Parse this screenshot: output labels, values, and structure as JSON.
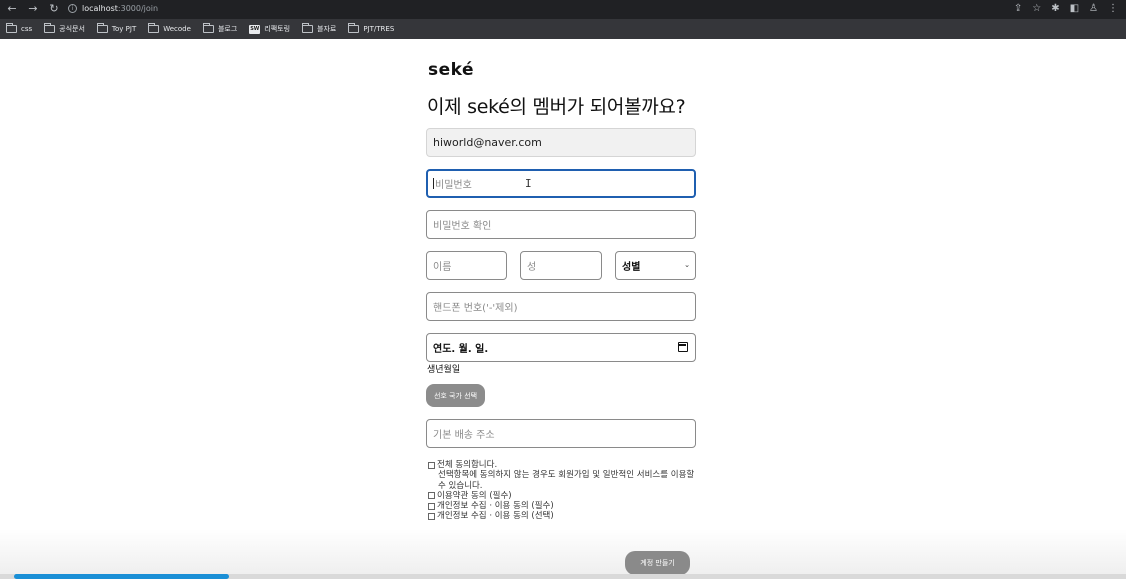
{
  "browser": {
    "url_host": "localhost",
    "url_path": ":3000/join",
    "bookmarks": [
      {
        "label": "css",
        "icon": "folder-icon"
      },
      {
        "label": "공식문서",
        "icon": "folder-icon"
      },
      {
        "label": "Toy PJT",
        "icon": "folder-icon"
      },
      {
        "label": "Wecode",
        "icon": "folder-icon"
      },
      {
        "label": "블로그",
        "icon": "folder-icon"
      },
      {
        "label": "리팩토링",
        "icon": "sw-icon"
      },
      {
        "label": "블자료",
        "icon": "folder-icon"
      },
      {
        "label": "PJT/TRES",
        "icon": "folder-icon"
      }
    ],
    "sw_badge": "SW"
  },
  "form": {
    "logo": "seké",
    "headline": "이제 seké의 멤버가 되어볼까요?",
    "email_value": "hiworld@naver.com",
    "password_placeholder": "비밀번호",
    "password_confirm_placeholder": "비밀번호 확인",
    "first_name_placeholder": "이름",
    "last_name_placeholder": "성",
    "gender_select_value": "성별",
    "phone_placeholder": "핸드폰 번호('-'제외)",
    "birth_date_placeholder": "연도. 월. 일.",
    "birth_label": "생년월일",
    "country_button": "선호 국가 선택",
    "address_placeholder": "기본 배송 주소",
    "agree_all": "전체 동의합니다.",
    "agree_all_desc": "선택항목에 동의하지 않는 경우도 회원가입 및 일반적인 서비스를 이용할 수 있습니다.",
    "agree_terms": "이용약관 동의 (필수)",
    "agree_privacy_required": "개인정보 수집 · 이용 동의 (필수)",
    "agree_privacy_optional": "개인정보 수집 · 이용 동의 (선택)",
    "submit_button": "계정 만들기"
  },
  "page_scroll_progress": 0.19,
  "colors": {
    "focus_border": "#1f5fb0",
    "button_gray": "#8a8a8a",
    "progress_blue": "#1a8fd6"
  }
}
